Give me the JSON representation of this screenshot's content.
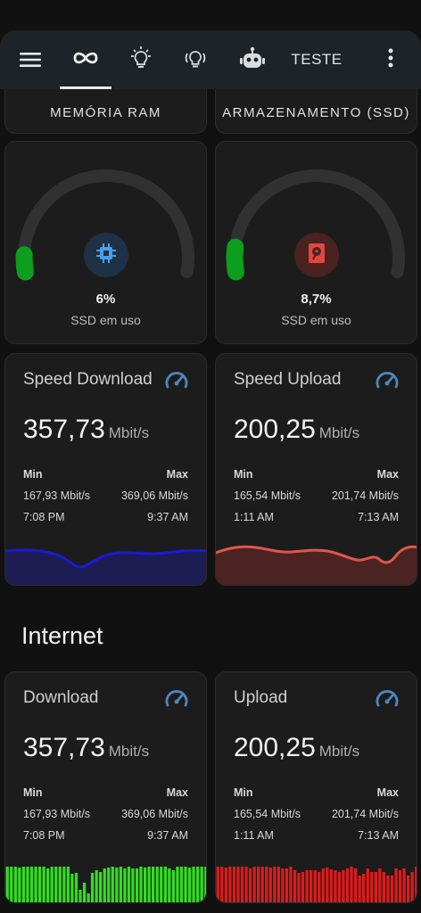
{
  "topbar": {
    "menu_icon": "hamburger-menu-icon",
    "tabs": [
      {
        "icon": "infinity-icon",
        "active": true
      },
      {
        "icon": "lightbulb-icon"
      },
      {
        "icon": "lamp-icon"
      },
      {
        "icon": "robot-icon"
      }
    ],
    "text_tab": "TESTE",
    "more_icon": "dots-vertical-icon"
  },
  "sensors_top": [
    {
      "label": "MEMÓRIA RAM"
    },
    {
      "label": "ARMAZENAMENTO (SSD)"
    }
  ],
  "gauges": [
    {
      "value": "6%",
      "label": "SSD em uso",
      "icon": "cpu-chip-icon",
      "percent": 6,
      "icon_color": "#42a5f5",
      "arc_color": "#0c9e1c"
    },
    {
      "value": "8,7%",
      "label": "SSD em uso",
      "icon": "harddisk-icon",
      "percent": 8.7,
      "icon_color": "#e53935",
      "arc_color": "#0c9e1c"
    }
  ],
  "speed_cards": [
    {
      "title": "Speed Download",
      "value": "357,73",
      "unit": "Mbit/s",
      "min_label": "Min",
      "max_label": "Max",
      "min_value": "167,93 Mbit/s",
      "max_value": "369,06 Mbit/s",
      "min_time": "7:08 PM",
      "max_time": "9:37 AM",
      "graph_color": "#1a1ad6"
    },
    {
      "title": "Speed Upload",
      "value": "200,25",
      "unit": "Mbit/s",
      "min_label": "Min",
      "max_label": "Max",
      "min_value": "165,54 Mbit/s",
      "max_value": "201,74 Mbit/s",
      "min_time": "1:11 AM",
      "max_time": "7:13 AM",
      "graph_color": "#e0574a"
    }
  ],
  "section": {
    "title": "Internet"
  },
  "internet_cards": [
    {
      "title": "Download",
      "value": "357,73",
      "unit": "Mbit/s",
      "min_label": "Min",
      "max_label": "Max",
      "min_value": "167,93 Mbit/s",
      "max_value": "369,06 Mbit/s",
      "min_time": "7:08 PM",
      "max_time": "9:37 AM",
      "graph_color": "#33dd22"
    },
    {
      "title": "Upload",
      "value": "200,25",
      "unit": "Mbit/s",
      "min_label": "Min",
      "max_label": "Max",
      "min_value": "165,54 Mbit/s",
      "max_value": "201,74 Mbit/s",
      "min_time": "1:11 AM",
      "max_time": "7:13 AM",
      "graph_color": "#dd1b1b"
    }
  ]
}
